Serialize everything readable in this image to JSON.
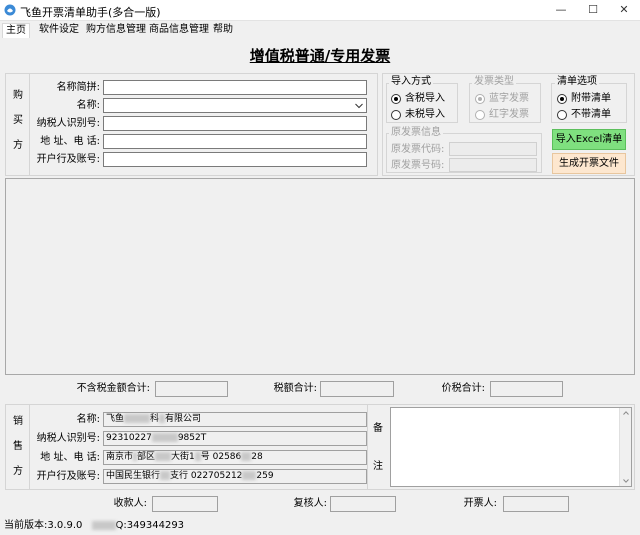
{
  "window": {
    "title": "飞鱼开票清单助手(多合一版)",
    "controls": [
      "—",
      "☐",
      "✕"
    ]
  },
  "menu": [
    "主页",
    "软件设定",
    "购方信息管理",
    "商品信息管理",
    "帮助"
  ],
  "page_title": "增值税普通/专用发票",
  "buyer": {
    "side_label": [
      "购",
      "买",
      "方"
    ],
    "fields": [
      {
        "label": "名称简拼:",
        "value": ""
      },
      {
        "label": "名称:",
        "value": ""
      },
      {
        "label": "纳税人识别号:",
        "value": ""
      },
      {
        "label": "地 址、电 话:",
        "value": ""
      },
      {
        "label": "开户行及账号:",
        "value": ""
      }
    ]
  },
  "import_method": {
    "title": "导入方式",
    "options": [
      {
        "label": "含税导入",
        "checked": true
      },
      {
        "label": "未税导入",
        "checked": false
      }
    ]
  },
  "invoice_type": {
    "title": "发票类型",
    "options": [
      {
        "label": "蓝字发票",
        "checked": true
      },
      {
        "label": "红字发票",
        "checked": false
      }
    ]
  },
  "list_option": {
    "title": "清单选项",
    "options": [
      {
        "label": "附带清单",
        "checked": true
      },
      {
        "label": "不带清单",
        "checked": false
      }
    ]
  },
  "original_invoice": {
    "title": "原发票信息",
    "code_label": "原发票代码:",
    "number_label": "原发票号码:"
  },
  "buttons": {
    "import_excel": "导入Excel清单",
    "generate": "生成开票文件"
  },
  "totals": {
    "amount_label": "不含税金额合计:",
    "tax_label": "税额合计:",
    "total_label": "价税合计:"
  },
  "seller": {
    "side_label": [
      "销",
      "售",
      "方"
    ],
    "fields": [
      {
        "label": "名称:",
        "value_parts": [
          "飞鱼",
          "",
          "科",
          "有限公司"
        ]
      },
      {
        "label": "纳税人识别号:",
        "value_parts": [
          "92310227",
          "",
          "9852T"
        ]
      },
      {
        "label": "地 址、电 话:",
        "value_parts": [
          "南京市",
          "",
          "部区",
          "",
          "大街1",
          "",
          "号 02586",
          "",
          "28"
        ]
      },
      {
        "label": "开户行及账号:",
        "value_parts": [
          "中国民生银行",
          "",
          "支行 022705212",
          "",
          "259"
        ]
      }
    ]
  },
  "remarks": {
    "label_top": "备",
    "label_bottom": "注"
  },
  "signers": {
    "payee": "收款人:",
    "reviewer": "复核人:",
    "issuer": "开票人:"
  },
  "status": {
    "version": "当前版本:3.0.9.0",
    "qq_prefix": "Q:349344293"
  },
  "colors": {
    "import_btn_bg": "#7fe07f",
    "generate_btn_bg": "#fde7cf",
    "title_icon": "#3b8ad6"
  }
}
